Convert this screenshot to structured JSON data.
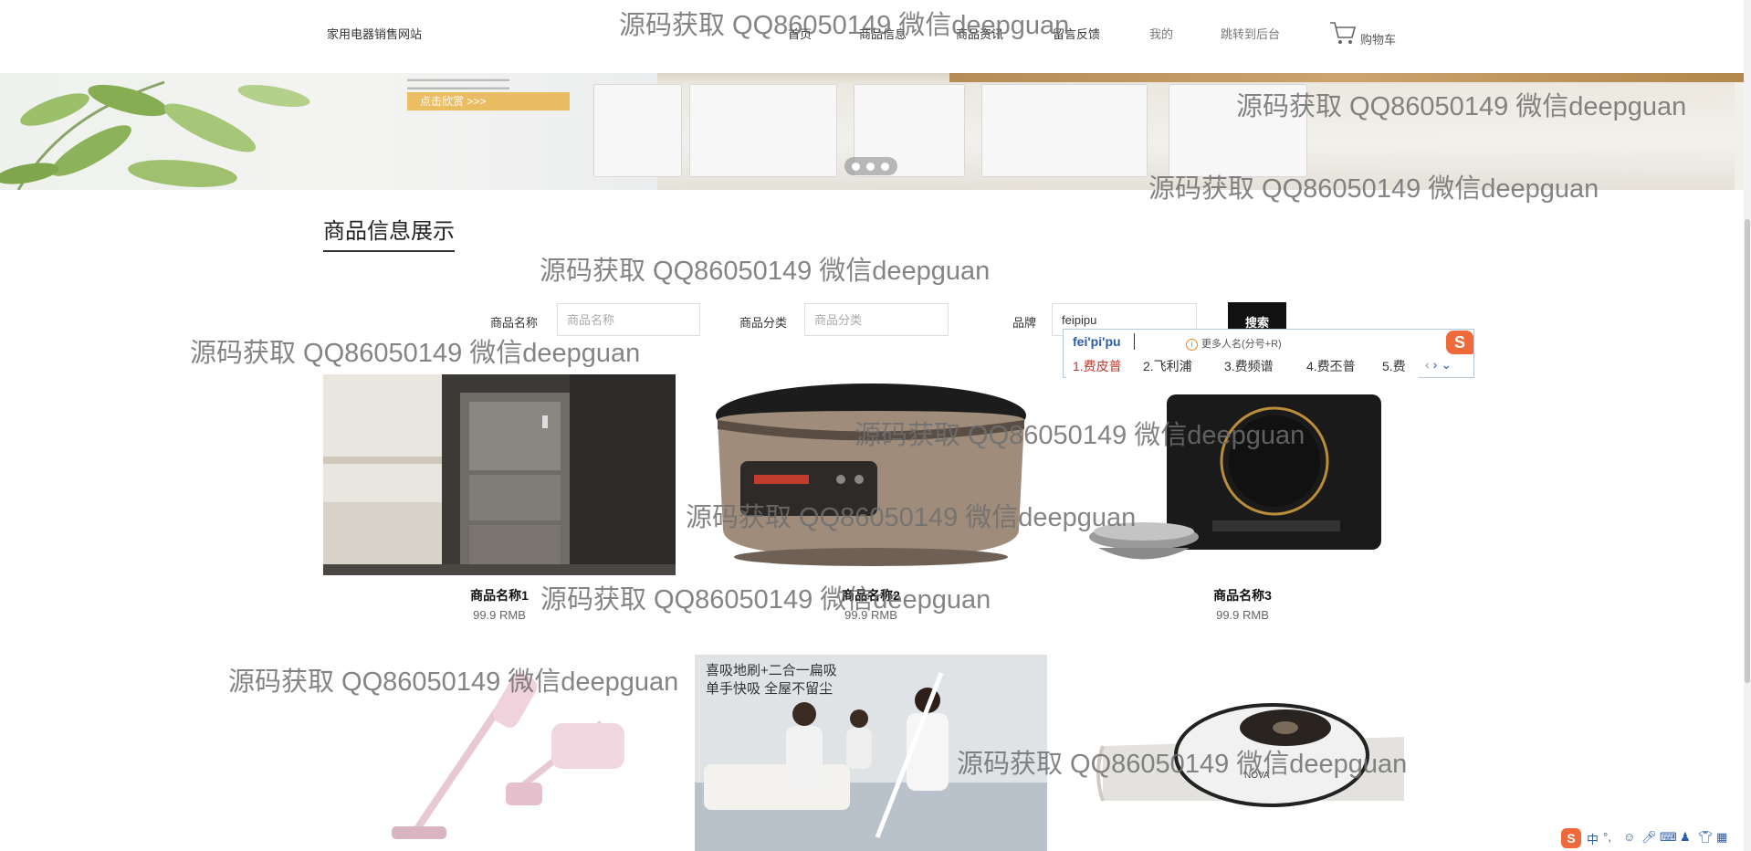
{
  "header": {
    "site_title": "家用电器销售网站",
    "nav": [
      {
        "label": "首页"
      },
      {
        "label": "商品信息"
      },
      {
        "label": "商品资讯"
      },
      {
        "label": "留言反馈"
      },
      {
        "label": "我的"
      },
      {
        "label": "跳转到后台"
      }
    ],
    "cart_label": "购物车"
  },
  "banner": {
    "cta_label": "点击欣赏 >>>",
    "slide_count": 3
  },
  "section_title": "商品信息展示",
  "search": {
    "name_label": "商品名称",
    "name_placeholder": "商品名称",
    "category_label": "商品分类",
    "category_placeholder": "商品分类",
    "brand_label": "品牌",
    "brand_value": "feipipu",
    "button_label": "搜索"
  },
  "ime_popup": {
    "pinyin": "fei'pi'pu",
    "info": "更多人名(分号+R)",
    "candidates": [
      "1.费皮普",
      "2.飞利浦",
      "3.费频谱",
      "4.费丕普",
      "5.费"
    ]
  },
  "products": [
    {
      "name": "商品名称1",
      "price": "99.9 RMB"
    },
    {
      "name": "商品名称2",
      "price": "99.9 RMB"
    },
    {
      "name": "商品名称3",
      "price": "99.9 RMB"
    },
    {
      "name": "",
      "price": ""
    },
    {
      "name": "",
      "price": ""
    },
    {
      "name": "",
      "price": ""
    }
  ],
  "product_images": {
    "p5_caption_line1": "喜吸地刷+二合一扁吸",
    "p5_caption_line2": "单手快吸 全屋不留尘",
    "p6_logo": "NOVA"
  },
  "ime_toolbar": {
    "mode": "中",
    "punct": "°,"
  },
  "watermark": "源码获取 QQ86050149 微信deepguan",
  "colors": {
    "search_button": "#111111",
    "ime_brand": "#ef6a3a",
    "ime_first_candidate": "#c0392b"
  }
}
